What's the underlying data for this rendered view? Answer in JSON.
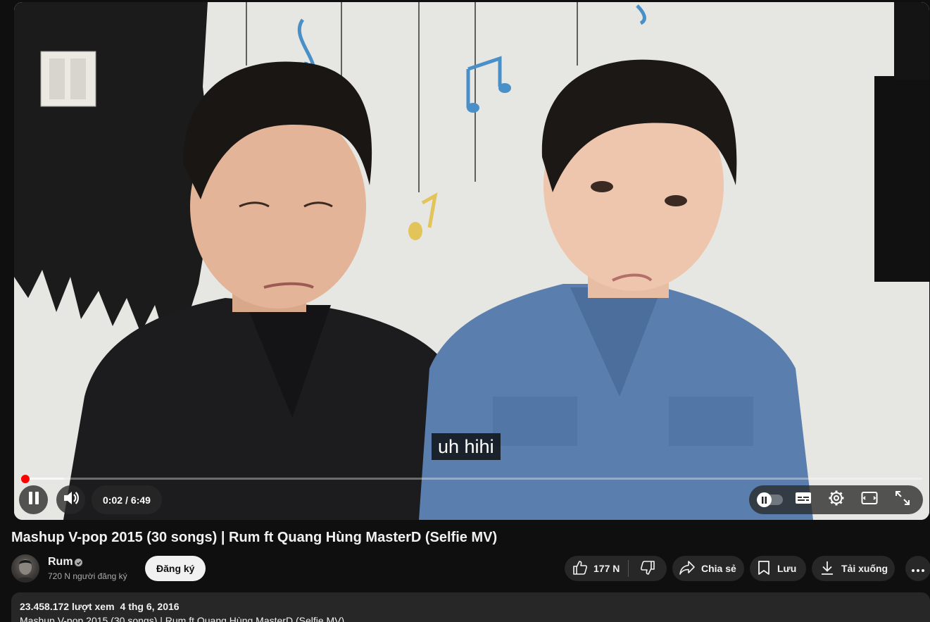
{
  "player": {
    "subtitle": "uh hihi",
    "time_current": "0:02",
    "time_separator": "/",
    "time_total": "6:49",
    "progress_played_fraction": 0.005,
    "progress_loaded_fraction": 0.048,
    "autoplay_on": true,
    "icons": {
      "pause": "pause-icon",
      "volume": "volume-icon",
      "autoplay": "autoplay-toggle-icon",
      "subtitles": "subtitles-icon",
      "settings": "gear-icon",
      "theater": "theater-mode-icon",
      "fullscreen": "fullscreen-icon"
    }
  },
  "video": {
    "title": "Mashup V-pop 2015 (30 songs) | Rum ft Quang Hùng MasterD (Selfie MV)"
  },
  "channel": {
    "name": "Rum",
    "subscribers": "720 N người đăng ký",
    "subscribe_label": "Đăng ký"
  },
  "actions": {
    "like_count": "177 N",
    "share_label": "Chia sẻ",
    "save_label": "Lưu",
    "download_label": "Tải xuống"
  },
  "description": {
    "views": "23.458.172 lượt xem",
    "date": "4 thg 6, 2016",
    "first_line": "Mashup V-pop 2015 (30 songs) | Rum ft Quang Hùng MasterD (Selfie MV)"
  },
  "colors": {
    "background": "#0f0f0f",
    "progress": "#ff0000",
    "button_bg": "#272727",
    "subscribe_bg": "#f1f1f1"
  }
}
